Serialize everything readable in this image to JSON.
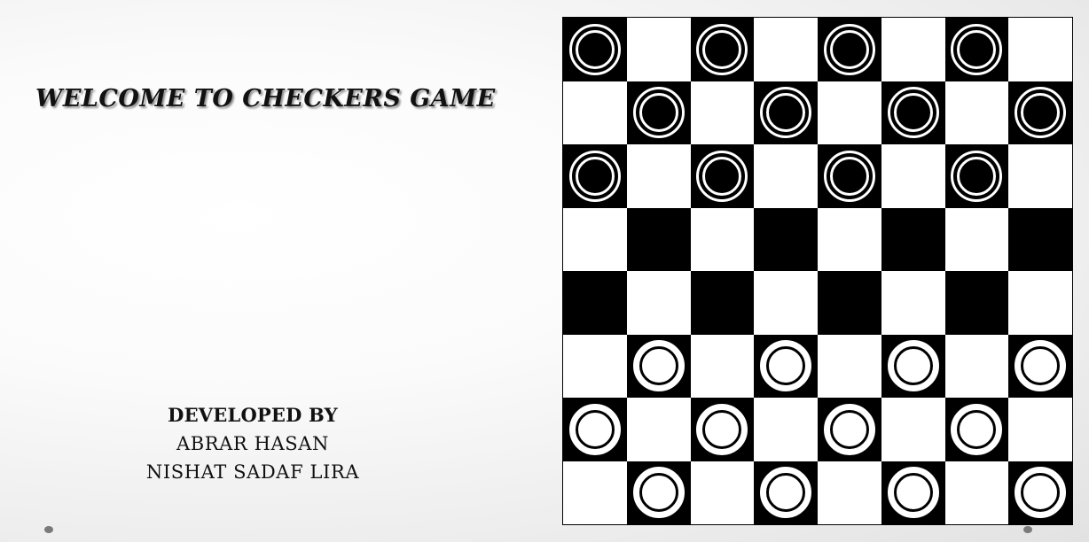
{
  "title": "WELCOME TO CHECKERS GAME",
  "credits": {
    "developed_by": "DEVELOPED BY",
    "authors": [
      "ABRAR HASAN",
      "NISHAT SADAF LIRA"
    ]
  },
  "colors": {
    "dark_square": "#000000",
    "light_square": "#ffffff",
    "dark_piece": "#000000",
    "light_piece": "#ffffff"
  },
  "board": {
    "size": 8,
    "top_left_square": "dark",
    "pieces": [
      "b.b.b.b.",
      ".b.b.b.b",
      "b.b.b.b.",
      "........",
      "........",
      ".w.w.w.w",
      "w.w.w.w.",
      ".w.w.w.w"
    ],
    "legend": {
      "b": "black-piece",
      "w": "white-piece",
      ".": "empty"
    }
  },
  "slide_dots": [
    "left-slide-dot",
    "right-slide-dot"
  ]
}
